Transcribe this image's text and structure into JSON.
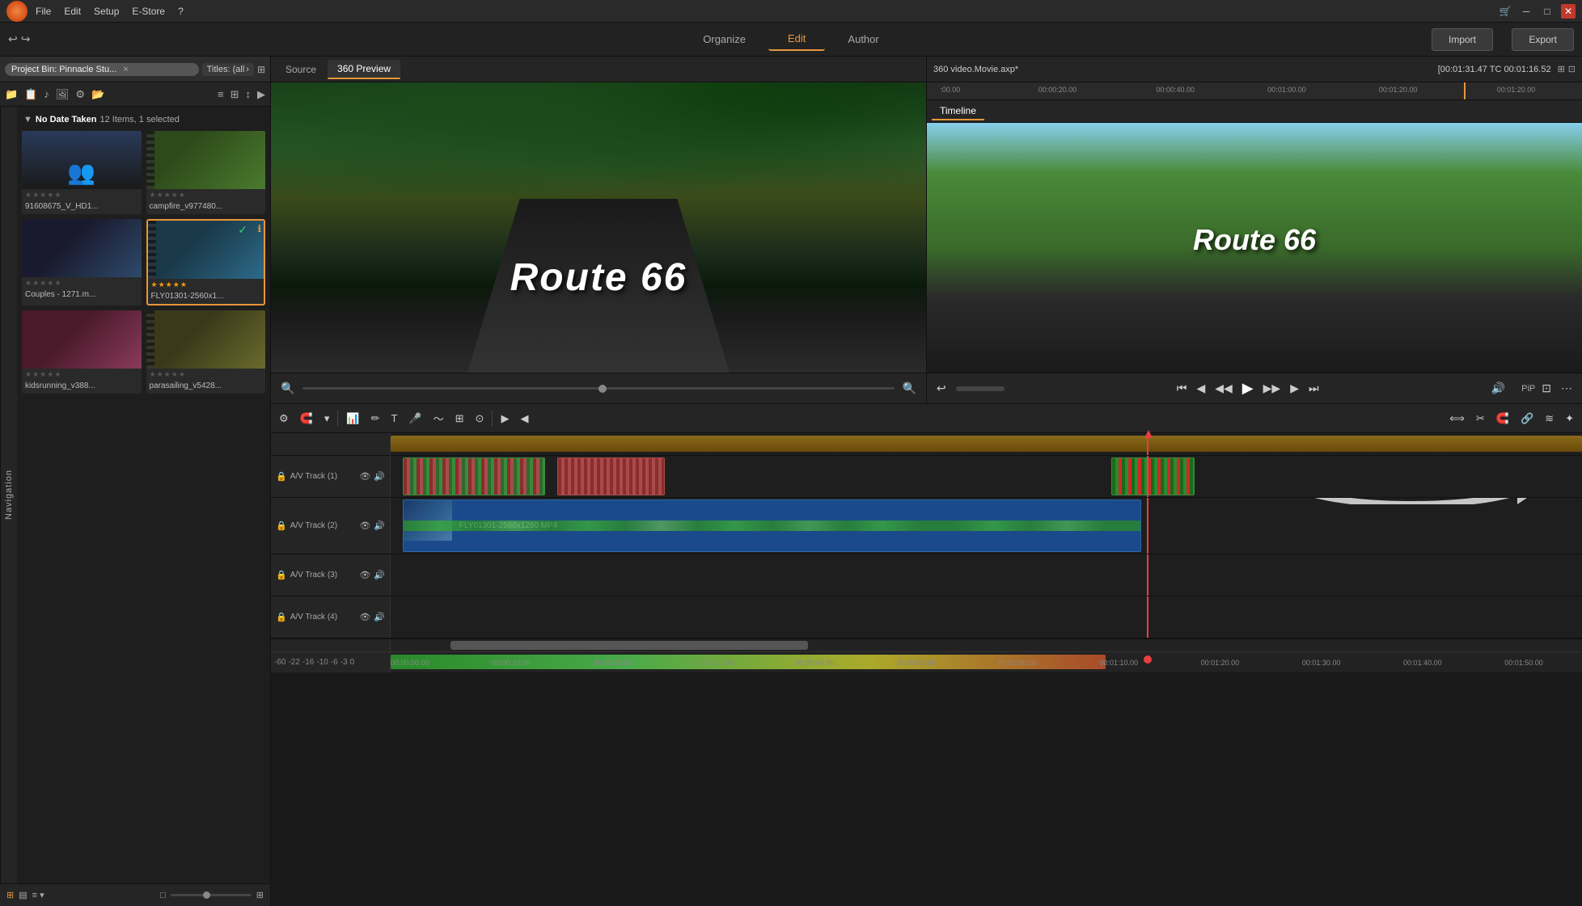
{
  "app": {
    "logo_alt": "Pinnacle Studio Logo"
  },
  "menu": {
    "items": [
      "File",
      "Edit",
      "Setup",
      "E-Store",
      "?"
    ]
  },
  "main_nav": {
    "tabs": [
      "Organize",
      "Edit",
      "Author"
    ],
    "active": "Edit",
    "import_label": "Import",
    "export_label": "Export"
  },
  "project_bin": {
    "label": "Project Bin: Pinnacle Stu...",
    "close": "×",
    "titles_label": "Titles: (all",
    "titles_arrow": "›",
    "item_count": "12 Items, 1 selected",
    "group_name": "No Date Taken",
    "items": [
      {
        "name": "91608675_V_HD1...",
        "thumb": "thumb-people",
        "stars": 0
      },
      {
        "name": "campfire_v977480...",
        "thumb": "thumb-2",
        "stars": 0
      },
      {
        "name": "Couples - 1271.m...",
        "thumb": "thumb-1",
        "stars": 0
      },
      {
        "name": "FLY01301-2560x1...",
        "thumb": "thumb-3",
        "stars": 5,
        "selected": true
      },
      {
        "name": "kidsrunning_v388...",
        "thumb": "thumb-5",
        "stars": 0
      },
      {
        "name": "parasailing_v5428...",
        "thumb": "thumb-6",
        "stars": 0
      }
    ]
  },
  "source_panel": {
    "tabs": [
      "Source",
      "360 Preview"
    ],
    "active_tab": "360 Preview",
    "route66_text": "Route 66"
  },
  "monitor_panel": {
    "title": "360 video.Movie.axp*",
    "timecode": "[00:01:31.47  TC 00:01:16.52",
    "tab": "Timeline",
    "route66_text": "Route 66"
  },
  "timeline": {
    "tracks": [
      {
        "id": "av1",
        "label": "A/V Track (1)"
      },
      {
        "id": "av2",
        "label": "A/V Track (2)"
      },
      {
        "id": "av3",
        "label": "A/V Track (3)"
      },
      {
        "id": "av4",
        "label": "A/V Track (4)"
      }
    ],
    "ruler_marks": [
      "00:00",
      "00:00:10.00",
      "00:00:20.00",
      "00:00:30.00",
      "00:00:40.00",
      "00:00:50.00",
      "00:01:00.00",
      "00:01:10.00",
      "00:01:20.00",
      "00:01:30.00",
      "00:01:40.00",
      "00:01:50.00"
    ],
    "bottom_ruler": [
      "-60",
      "-22",
      "-16",
      "-10",
      "-6",
      "-3",
      "0"
    ],
    "clip_label": "FLY01301-2560x1280 MP4"
  },
  "icons": {
    "play": "▶",
    "pause": "⏸",
    "stop": "⏹",
    "prev_frame": "⏮",
    "next_frame": "⏭",
    "rewind": "⏪",
    "fast_forward": "⏩",
    "undo": "↩",
    "redo": "↪",
    "eye": "👁",
    "lock": "🔒",
    "audio": "🔊",
    "zoom_in": "🔍",
    "zoom_out": "🔍",
    "mute": "🔇",
    "scissors": "✂",
    "trash": "🗑",
    "camera": "📷",
    "pip": "PiP"
  },
  "navigation_label": "Navigation"
}
